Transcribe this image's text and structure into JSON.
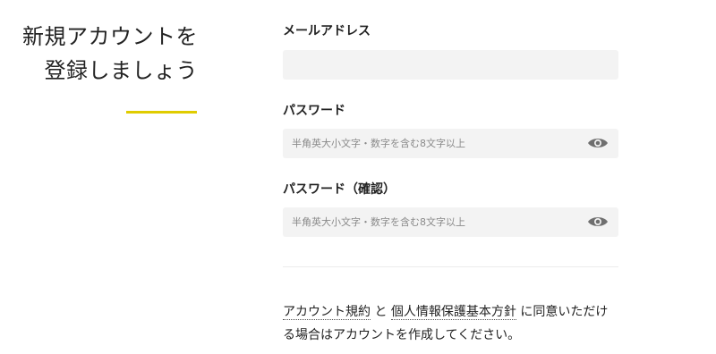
{
  "heading": {
    "line1": "新規アカウントを",
    "line2": "登録しましょう"
  },
  "colors": {
    "accent": "#e0cc00",
    "field_background": "#f3f3f3"
  },
  "form": {
    "email": {
      "label": "メールアドレス",
      "value": "",
      "placeholder": ""
    },
    "password": {
      "label": "パスワード",
      "value": "",
      "placeholder": "半角英大小文字・数字を含む8文字以上",
      "toggle_icon": "eye-icon"
    },
    "password_confirm": {
      "label": "パスワード（確認）",
      "value": "",
      "placeholder": "半角英大小文字・数字を含む8文字以上",
      "toggle_icon": "eye-icon"
    }
  },
  "terms": {
    "link_terms": "アカウント規約",
    "connector": " と ",
    "link_privacy": "個人情報保護基本方針",
    "text_rest": " に同意いただける場合はアカウントを作成してください。"
  }
}
